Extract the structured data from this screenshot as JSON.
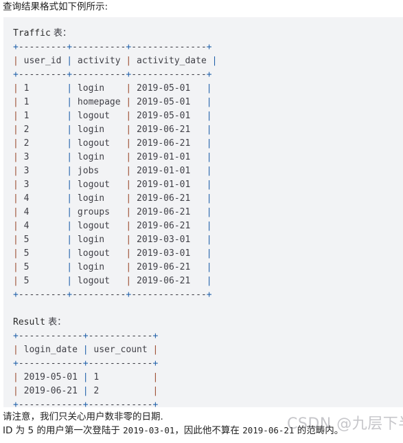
{
  "intro": {
    "text": "查询结果格式如下例所示:"
  },
  "code_block": {
    "traffic": {
      "title": "Traffic 表：",
      "title_label": "Traffic",
      "title_suffix": " 表：",
      "rule": "+---------+----------+--------------+",
      "header": "| user_id | activity | activity_date |",
      "header_cells": [
        "user_id",
        "activity",
        "activity_date"
      ],
      "rows": [
        {
          "user_id": "1",
          "activity": "login",
          "activity_date": "2019-05-01"
        },
        {
          "user_id": "1",
          "activity": "homepage",
          "activity_date": "2019-05-01"
        },
        {
          "user_id": "1",
          "activity": "logout",
          "activity_date": "2019-05-01"
        },
        {
          "user_id": "2",
          "activity": "login",
          "activity_date": "2019-06-21"
        },
        {
          "user_id": "2",
          "activity": "logout",
          "activity_date": "2019-06-21"
        },
        {
          "user_id": "3",
          "activity": "login",
          "activity_date": "2019-01-01"
        },
        {
          "user_id": "3",
          "activity": "jobs",
          "activity_date": "2019-01-01"
        },
        {
          "user_id": "3",
          "activity": "logout",
          "activity_date": "2019-01-01"
        },
        {
          "user_id": "4",
          "activity": "login",
          "activity_date": "2019-06-21"
        },
        {
          "user_id": "4",
          "activity": "groups",
          "activity_date": "2019-06-21"
        },
        {
          "user_id": "4",
          "activity": "logout",
          "activity_date": "2019-06-21"
        },
        {
          "user_id": "5",
          "activity": "login",
          "activity_date": "2019-03-01"
        },
        {
          "user_id": "5",
          "activity": "logout",
          "activity_date": "2019-03-01"
        },
        {
          "user_id": "5",
          "activity": "login",
          "activity_date": "2019-06-21"
        },
        {
          "user_id": "5",
          "activity": "logout",
          "activity_date": "2019-06-21"
        }
      ],
      "rendered": [
        "+---------+----------+--------------+",
        "| user_id | activity | activity_date |",
        "+---------+----------+--------------+",
        "| 1       | login    | 2019-05-01   |",
        "| 1       | homepage | 2019-05-01   |",
        "| 1       | logout   | 2019-05-01   |",
        "| 2       | login    | 2019-06-21   |",
        "| 2       | logout   | 2019-06-21   |",
        "| 3       | login    | 2019-01-01   |",
        "| 3       | jobs     | 2019-01-01   |",
        "| 3       | logout   | 2019-01-01   |",
        "| 4       | login    | 2019-06-21   |",
        "| 4       | groups   | 2019-06-21   |",
        "| 4       | logout   | 2019-06-21   |",
        "| 5       | login    | 2019-03-01   |",
        "| 5       | logout   | 2019-03-01   |",
        "| 5       | login    | 2019-06-21   |",
        "| 5       | logout   | 2019-06-21   |",
        "+---------+----------+--------------+"
      ]
    },
    "result": {
      "title": "Result 表：",
      "title_label": "Result",
      "title_suffix": " 表：",
      "rule": "+------------+------------+",
      "header": "| login_date | user_count |",
      "header_cells": [
        "login_date",
        "user_count"
      ],
      "rows": [
        {
          "login_date": "2019-05-01",
          "user_count": "1"
        },
        {
          "login_date": "2019-06-21",
          "user_count": "2"
        }
      ],
      "rendered": [
        "+------------+------------+",
        "| login_date | user_count |",
        "+------------+------------+",
        "| 2019-05-01 | 1          |",
        "| 2019-06-21 | 2          |",
        "+------------+------------+"
      ]
    }
  },
  "notes": {
    "line1": "请注意，我们只关心用户数非零的日期.",
    "line2_prefix": "ID 为 5 的用户第一次登陆于 ",
    "line2_date1": "2019-03-01",
    "line2_middle": "，因此他不算在 ",
    "line2_date2": "2019-06-21",
    "line2_suffix": " 的范畴内。"
  },
  "watermark": {
    "text": "CSDN @九层下半"
  },
  "colors": {
    "code_background": "#f2f3f5",
    "page_background": "#ffffff",
    "text": "#1f1f1f",
    "code_text": "#3f3f46",
    "pipe_orange": "#9b4b2e",
    "pipe_blue": "#1f5fa9",
    "watermark": "rgba(120,120,128,0.42)"
  }
}
